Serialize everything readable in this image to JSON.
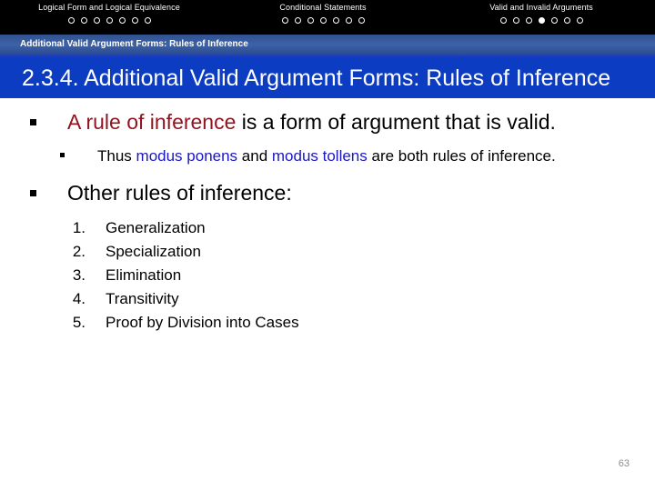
{
  "topbar": {
    "groups": [
      {
        "title": "Logical Form and Logical Equivalence",
        "dots": [
          "empty",
          "empty",
          "empty",
          "empty",
          "empty",
          "empty",
          "empty"
        ]
      },
      {
        "title": "Conditional Statements",
        "dots": [
          "empty",
          "empty",
          "empty",
          "empty",
          "empty",
          "empty",
          "empty"
        ]
      },
      {
        "title": "Valid and Invalid Arguments",
        "dots": [
          "empty",
          "empty",
          "empty",
          "filled",
          "empty",
          "empty",
          "empty"
        ]
      }
    ]
  },
  "subband": {
    "text": "Additional Valid Argument Forms: Rules of Inference"
  },
  "title": {
    "text": "2.3.4. Additional Valid Argument Forms: Rules of Inference"
  },
  "content": {
    "bullet1": {
      "highlight": "A rule of inference",
      "rest": " is a form of argument that is valid."
    },
    "subbullet1": {
      "part1": "Thus ",
      "term1": "modus ponens",
      "part2": " and ",
      "term2": "modus tollens",
      "part3": " are both rules of inference."
    },
    "bullet2": {
      "text": "Other rules of inference:"
    },
    "numbered_list": [
      {
        "num": "1.",
        "label": "Generalization"
      },
      {
        "num": "2.",
        "label": "Specialization"
      },
      {
        "num": "3.",
        "label": "Elimination"
      },
      {
        "num": "4.",
        "label": "Transitivity"
      },
      {
        "num": "5.",
        "label": "Proof by Division into Cases"
      }
    ]
  },
  "footer": {
    "page_number": "63"
  },
  "colors": {
    "nav_bar": "#000000",
    "subband": "#3d62a8",
    "title_banner": "#0b3cc1",
    "highlight_red": "#8f1520",
    "highlight_blue": "#1a17c4",
    "page_number": "#8d8d8d"
  }
}
